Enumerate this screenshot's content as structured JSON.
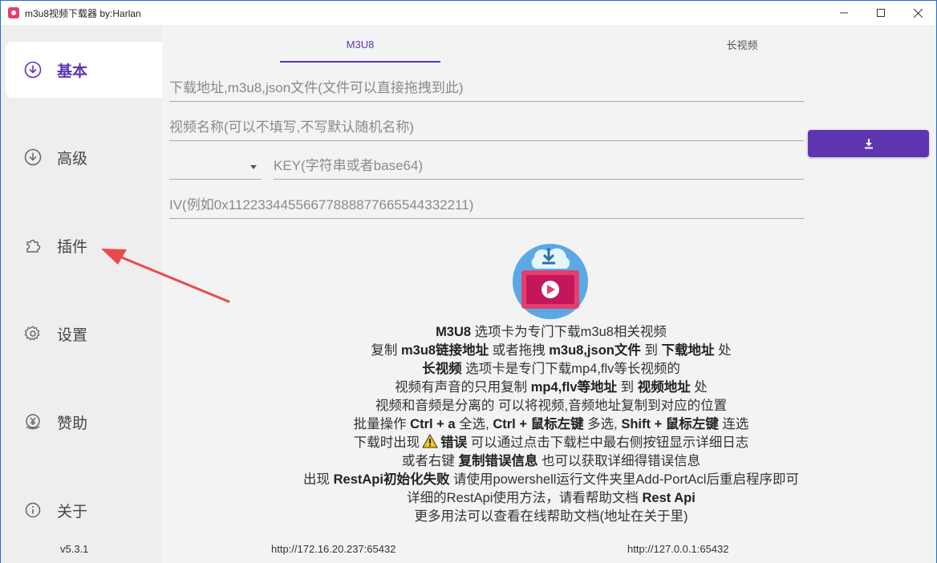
{
  "window": {
    "title": "m3u8视频下载器 by:Harlan",
    "controls": {
      "minimize": "—",
      "maximize": "☐",
      "close": "✕"
    }
  },
  "sidebar": {
    "items": [
      {
        "label": "基本",
        "icon": "download-circle-icon",
        "active": true
      },
      {
        "label": "高级",
        "icon": "download-circle-icon",
        "active": false
      },
      {
        "label": "插件",
        "icon": "puzzle-icon",
        "active": false
      },
      {
        "label": "设置",
        "icon": "gear-icon",
        "active": false
      },
      {
        "label": "赞助",
        "icon": "yen-circle-icon",
        "active": false
      },
      {
        "label": "关于",
        "icon": "info-icon",
        "active": false
      }
    ],
    "version": "v5.3.1"
  },
  "tabs": [
    {
      "label": "M3U8",
      "active": true
    },
    {
      "label": "长视频",
      "active": false
    }
  ],
  "form": {
    "url_placeholder": "下载地址,m3u8,json文件(文件可以直接拖拽到此)",
    "url_value": "",
    "name_placeholder": "视频名称(可以不填写,不写默认随机名称)",
    "name_value": "",
    "method_value": "",
    "key_placeholder": "KEY(字符串或者base64)",
    "key_value": "",
    "iv_placeholder": "IV(例如0x11223344556677888877665544332211)",
    "iv_value": ""
  },
  "download_button": {
    "icon": "download-icon"
  },
  "help": {
    "line1": {
      "b1": "M3U8",
      "t1": " 选项卡为专门下载m3u8相关视频"
    },
    "line2": {
      "t1": "复制 ",
      "b1": "m3u8链接地址",
      "t2": " 或者拖拽 ",
      "b2": "m3u8,json文件",
      "t3": " 到 ",
      "b3": "下载地址",
      "t4": " 处"
    },
    "line3": {
      "b1": "长视频",
      "t1": " 选项卡是专门下载mp4,flv等长视频的"
    },
    "line4": {
      "t1": "视频有声音的只用复制 ",
      "b1": "mp4,flv等地址",
      "t2": " 到 ",
      "b2": "视频地址",
      "t3": " 处"
    },
    "line5": {
      "t1": "视频和音频是分离的 可以将视频,音频地址复制到对应的位置"
    },
    "line6": {
      "t1": "批量操作 ",
      "b1": "Ctrl + a",
      "t2": " 全选, ",
      "b2": "Ctrl + 鼠标左键",
      "t3": " 多选, ",
      "b3": "Shift + 鼠标左键",
      "t4": " 连选"
    },
    "line7": {
      "t1": "下载时出现",
      "b1": "错误",
      "t2": " 可以通过点击下载栏中最右侧按钮显示详细日志"
    },
    "line8": {
      "t1": "或者右键 ",
      "b1": "复制错误信息",
      "t2": " 也可以获取详细得错误信息"
    },
    "line9": {
      "t1": "出现 ",
      "b1": "RestApi初始化失败",
      "t2": " 请使用powershell运行文件夹里Add-PortAcl后重启程序即可"
    },
    "line10": {
      "t1": "详细的RestApi使用方法，请看帮助文档 ",
      "b1": "Rest Api"
    },
    "line11": {
      "t1": "更多用法可以查看在线帮助文档(地址在关于里)"
    }
  },
  "status": {
    "left_url": "http://172.16.20.237:65432",
    "right_url": "http://127.0.0.1:65432"
  },
  "colors": {
    "accent": "#5e35b1",
    "annotation_arrow": "#e74c4c",
    "window_frame": "#1f6fd1"
  }
}
